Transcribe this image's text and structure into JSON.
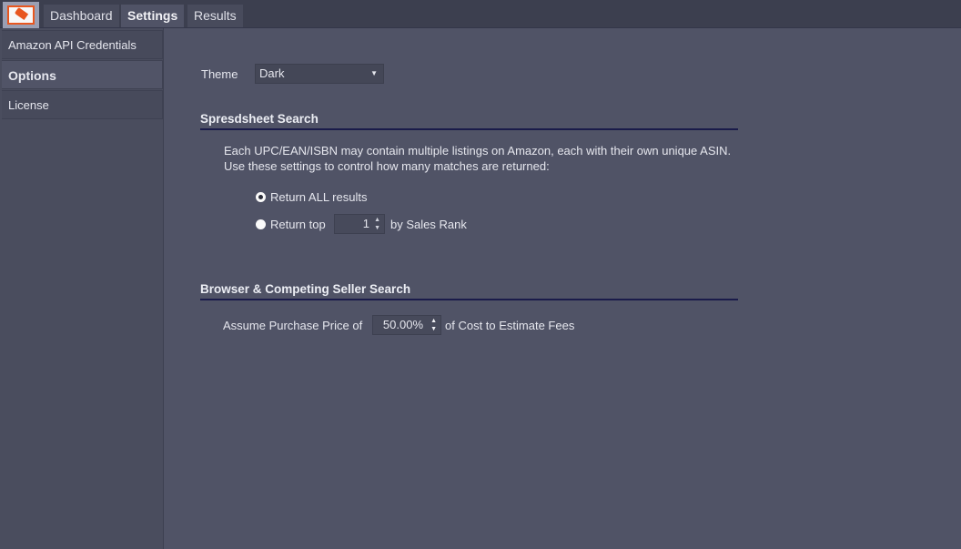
{
  "app": {
    "logo_icon": "price-tag-icon"
  },
  "tabs": [
    {
      "label": "Dashboard",
      "active": false
    },
    {
      "label": "Settings",
      "active": true
    },
    {
      "label": "Results",
      "active": false
    }
  ],
  "sidebar": {
    "items": [
      {
        "label": "Amazon API Credentials",
        "active": false
      },
      {
        "label": "Options",
        "active": true
      },
      {
        "label": "License",
        "active": false
      }
    ]
  },
  "options": {
    "theme_label": "Theme",
    "theme_value": "Dark",
    "spreadsheet": {
      "title": "Spresdsheet Search",
      "description_line1": "Each UPC/EAN/ISBN may contain multiple listings on Amazon, each with their own unique ASIN.",
      "description_line2": "Use these settings to control how many matches are returned:",
      "radio_all_label": "Return ALL results",
      "radio_all_checked": true,
      "radio_top_label": "Return top",
      "radio_top_checked": false,
      "top_count": "1",
      "top_suffix": "by Sales Rank"
    },
    "browser": {
      "title": "Browser & Competing Seller Search",
      "purchase_prefix": "Assume Purchase Price of",
      "purchase_value": "50.00%",
      "purchase_suffix": "of Cost to Estimate Fees"
    }
  }
}
